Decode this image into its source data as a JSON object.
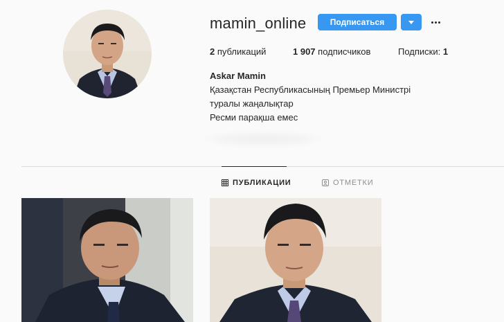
{
  "profile": {
    "username": "mamin_online",
    "follow_label": "Подписаться",
    "stats": {
      "posts_count": "2",
      "posts_label": "публикаций",
      "followers_count": "1 907",
      "followers_label": "подписчиков",
      "following_label": "Подписки:",
      "following_count": "1"
    },
    "bio": {
      "name": "Askar Mamin",
      "lines": [
        "Қазақстан Республикасының Премьер Министрі",
        "туралы жаңалықтар",
        "Ресми парақша емес"
      ]
    }
  },
  "tabs": [
    {
      "label": "ПУБЛИКАЦИИ",
      "icon": "grid-icon",
      "active": true
    },
    {
      "label": "ОТМЕТКИ",
      "icon": "tag-icon",
      "active": false
    }
  ],
  "colors": {
    "accent": "#3897f0",
    "background": "#fafafa",
    "divider": "#dbdbdb",
    "text": "#262626",
    "muted": "#8e8e8e"
  }
}
